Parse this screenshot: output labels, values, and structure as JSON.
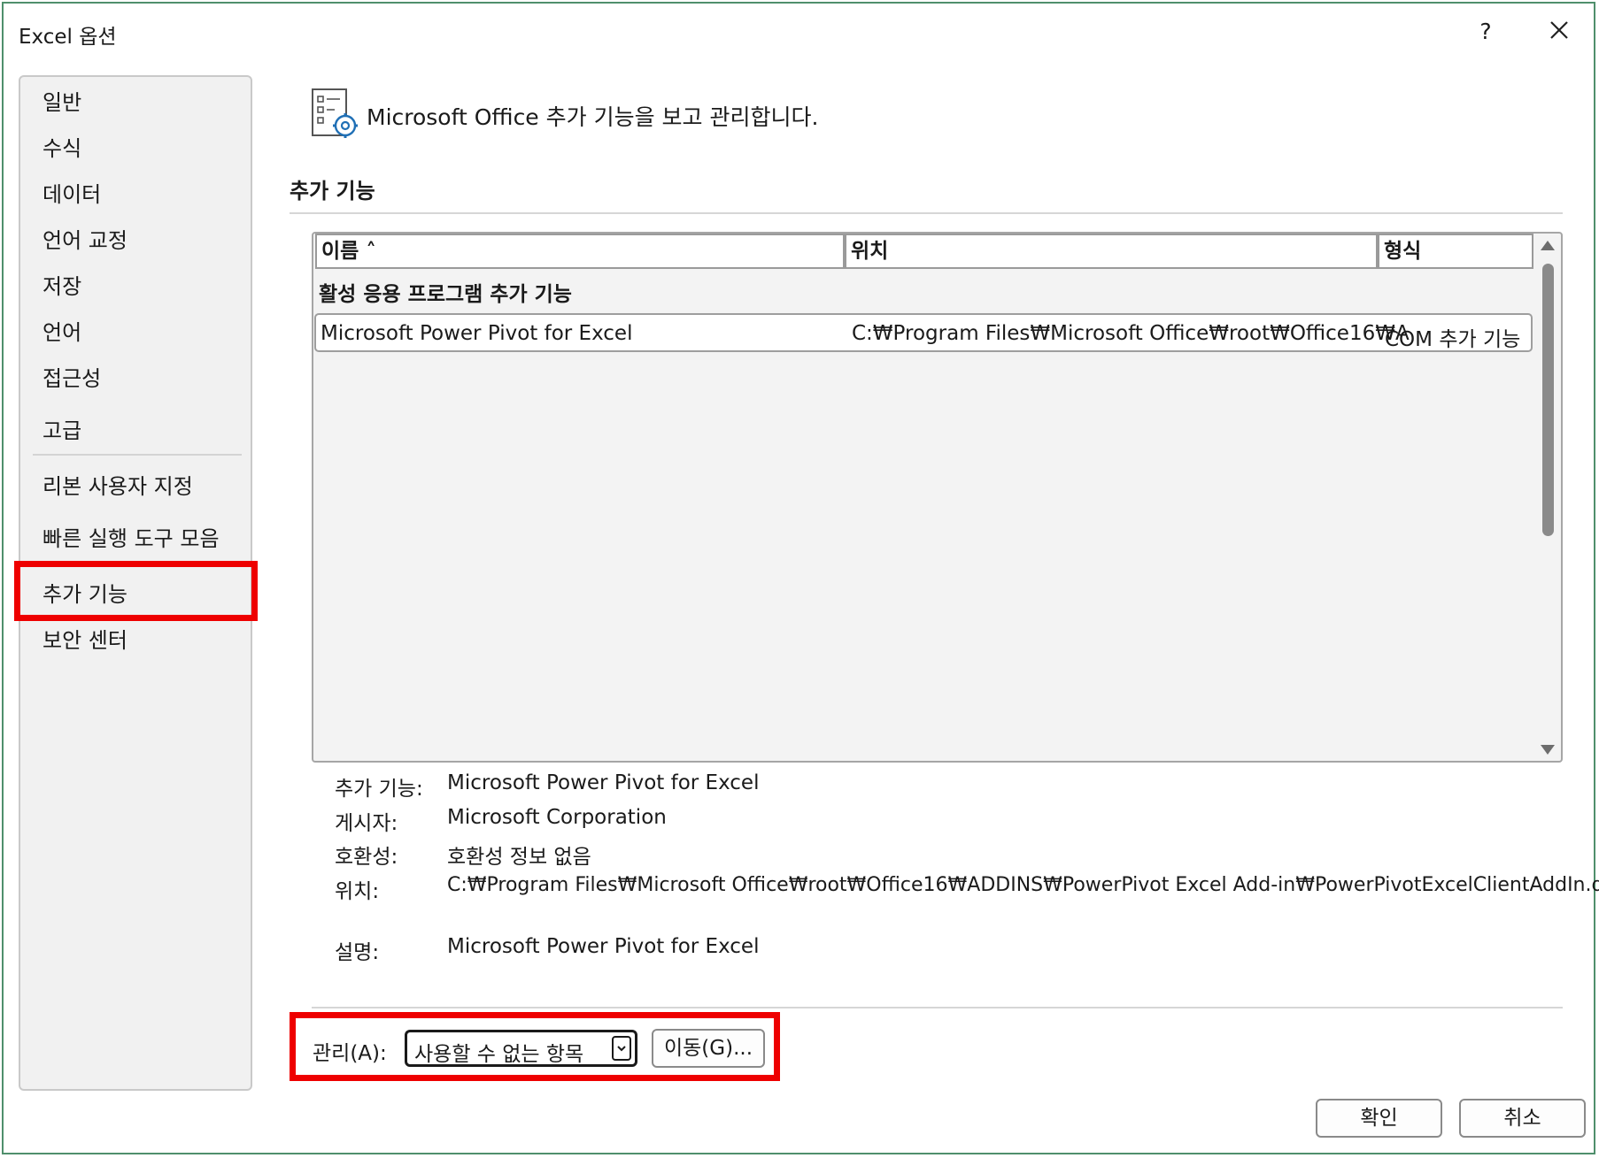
{
  "window": {
    "title": "Excel 옵션",
    "help_label": "?"
  },
  "sidebar": {
    "items": [
      {
        "label": "일반"
      },
      {
        "label": "수식"
      },
      {
        "label": "데이터"
      },
      {
        "label": "언어 교정"
      },
      {
        "label": "저장"
      },
      {
        "label": "언어"
      },
      {
        "label": "접근성"
      },
      {
        "label": "고급"
      },
      {
        "label": "리본 사용자 지정"
      },
      {
        "label": "빠른 실행 도구 모음"
      },
      {
        "label": "추가 기능"
      },
      {
        "label": "보안 센터"
      }
    ],
    "selected": "추가 기능"
  },
  "main": {
    "header_text": "Microsoft Office 추가 기능을 보고 관리합니다.",
    "section_title": "추가 기능",
    "table": {
      "columns": [
        "이름 ˄",
        "위치",
        "형식"
      ],
      "group_label": "활성 응용 프로그램 추가 기능",
      "rows": [
        {
          "name": "Microsoft Power Pivot for Excel",
          "location": "C:₩Program Files₩Microsoft Office₩root₩Office16₩A",
          "type": "COM 추가 기능"
        }
      ]
    },
    "details": {
      "addin_label": "추가 기능:",
      "addin_value": "Microsoft Power Pivot for Excel",
      "publisher_label": "게시자:",
      "publisher_value": "Microsoft Corporation",
      "compat_label": "호환성:",
      "compat_value": "호환성 정보 없음",
      "location_label": "위치:",
      "location_value": "C:₩Program Files₩Microsoft Office₩root₩Office16₩ADDINS₩PowerPivot Excel Add-in₩PowerPivotExcelClientAddIn.dll",
      "description_label": "설명:",
      "description_value": "Microsoft Power Pivot for Excel"
    },
    "manage": {
      "label": "관리(A):",
      "selected_option": "사용할 수 없는 항목",
      "go_button": "이동(G)..."
    }
  },
  "footer": {
    "ok_button": "확인",
    "cancel_button": "취소"
  },
  "colors": {
    "highlight_box": "#ee0000",
    "window_border": "#4f8f6c"
  }
}
